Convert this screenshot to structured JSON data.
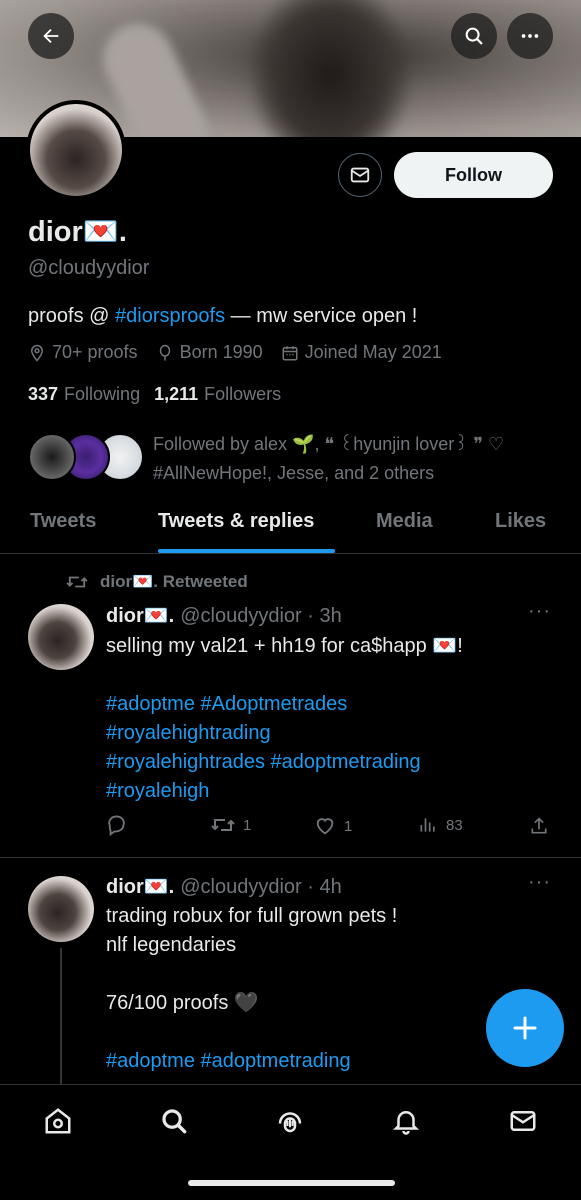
{
  "profile": {
    "name": "dior💌.",
    "handle": "@cloudyydior",
    "bio_prefix": "proofs @ ",
    "bio_link": "#diorsproofs",
    "bio_suffix": " — mw service open !",
    "location": "70+ proofs",
    "born": "Born 1990",
    "joined": "Joined May 2021",
    "following_count": "337",
    "following_label": "Following",
    "followers_count": "1,211",
    "followers_label": "Followers",
    "followed_by_line1": "Followed by alex 🌱, ❝ ꒰hyunjin lover꒱ ❞ ♡",
    "followed_by_line2": "#AllNewHope!, Jesse, and 2 others",
    "follow_button": "Follow"
  },
  "tabs": [
    {
      "label": "Tweets",
      "active": false
    },
    {
      "label": "Tweets & replies",
      "active": true
    },
    {
      "label": "Media",
      "active": false
    },
    {
      "label": "Likes",
      "active": false
    }
  ],
  "tweets": [
    {
      "retweet_label": "dior💌. Retweeted",
      "author": "dior💌.",
      "handle_time": "@cloudyydior · 3h",
      "text": "selling my val21 + hh19 for ca$happ 💌!",
      "hashtags_line1": "#adoptme #Adoptmetrades",
      "hashtags_line2": "#royalehightrading",
      "hashtags_line3": "#royalehightrades #adoptmetrading",
      "hashtags_line4": "#royalehigh",
      "retweets": "1",
      "likes": "1",
      "views": "83"
    },
    {
      "author": "dior💌.",
      "handle_time": "@cloudyydior · 4h",
      "text_line1": "trading robux for full grown pets !",
      "text_line2": "nlf legendaries",
      "text_line3": "76/100 proofs 🖤",
      "hashtags_line1": "#adoptme #adoptmetrading"
    }
  ],
  "icons": {
    "back": "arrow-left-icon",
    "search": "search-icon",
    "more": "more-icon",
    "message": "envelope-icon"
  },
  "colors": {
    "accent": "#1d9bf0",
    "background": "#000000",
    "muted": "#71767b"
  }
}
